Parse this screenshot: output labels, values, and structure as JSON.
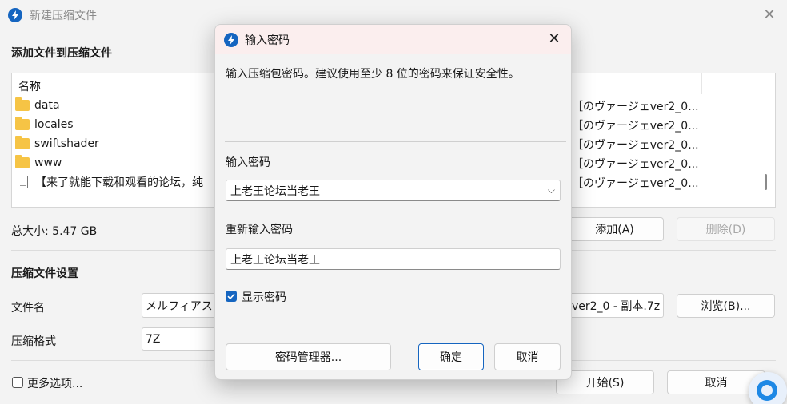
{
  "window": {
    "title": "新建压缩文件",
    "close_glyph": "✕",
    "icon": "lightning-bolt-icon",
    "brand_color": "#1565c0"
  },
  "files": {
    "heading": "添加文件到压缩文件",
    "column_name": "名称",
    "rows": [
      {
        "name": "data",
        "type": "folder",
        "right": "［のヴァージェver2_0..."
      },
      {
        "name": "locales",
        "type": "folder",
        "right": "［のヴァージェver2_0..."
      },
      {
        "name": "swiftshader",
        "type": "folder",
        "right": "［のヴァージェver2_0..."
      },
      {
        "name": "www",
        "type": "folder",
        "right": "［のヴァージェver2_0..."
      },
      {
        "name": "【来了就能下载和观看的论坛，纯",
        "type": "file",
        "right": "［のヴァージェver2_0..."
      }
    ],
    "total_size": "总大小: 5.47 GB",
    "add_button": "添加(A)",
    "delete_button": "删除(D)"
  },
  "settings": {
    "heading": "压缩文件设置",
    "filename_label": "文件名",
    "filename_value": "メルフィアス",
    "filename_suffix": "ver2_0 - 副本.7z",
    "browse_button": "浏览(B)...",
    "format_label": "压缩格式",
    "format_value": "7Z"
  },
  "footer": {
    "more_options": "更多选项...",
    "start_button": "开始(S)",
    "cancel_button": "取消"
  },
  "dialog": {
    "title": "输入密码",
    "close_glyph": "✕",
    "description": "输入压缩包密码。建议使用至少 8 位的密码来保证安全性。",
    "password_label": "输入密码",
    "password_value": "上老王论坛当老王",
    "confirm_label": "重新输入密码",
    "confirm_value": "上老王论坛当老王",
    "show_password_label": "显示密码",
    "show_password_checked": true,
    "manager_button": "密码管理器...",
    "ok_button": "确定",
    "cancel_button": "取消"
  }
}
